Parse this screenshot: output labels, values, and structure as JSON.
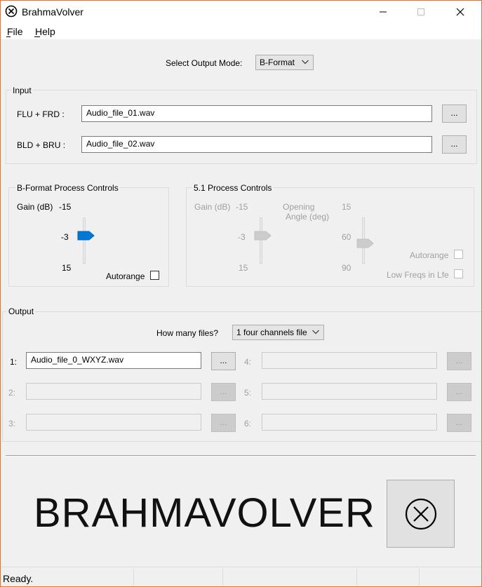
{
  "window": {
    "title": "BrahmaVolver",
    "icon": "circle-x-icon"
  },
  "menu": {
    "file": "File",
    "help": "Help"
  },
  "output_mode": {
    "label": "Select Output Mode:",
    "value": "B-Format"
  },
  "input": {
    "title": "Input",
    "row1_label": "FLU + FRD :",
    "row1_value": "Audio_file_01.wav",
    "row2_label": "BLD + BRU :",
    "row2_value": "Audio_file_02.wav",
    "browse": "..."
  },
  "bformat": {
    "title": "B-Format Process Controls",
    "gain_label": "Gain (dB)",
    "gain_min": "-15",
    "gain_mid": "-3",
    "gain_max": "15",
    "gain_value": -3,
    "autorange": "Autorange",
    "autorange_checked": false
  },
  "five_one": {
    "title": "5.1 Process Controls",
    "gain_label": "Gain (dB)",
    "gain_min": "-15",
    "gain_mid": "-3",
    "gain_max": "15",
    "opening_label": "Opening",
    "angle_label": "Angle (deg)",
    "angle_min": "15",
    "angle_mid": "60",
    "angle_max": "90",
    "autorange": "Autorange",
    "low_freqs": "Low Freqs in Lfe"
  },
  "output": {
    "title": "Output",
    "files_label": "How many files?",
    "files_value": "1 four channels file",
    "browse": "...",
    "slots": [
      {
        "label": "1:",
        "value": "Audio_file_0_WXYZ.wav",
        "enabled": true
      },
      {
        "label": "2:",
        "value": "",
        "enabled": false
      },
      {
        "label": "3:",
        "value": "",
        "enabled": false
      },
      {
        "label": "4:",
        "value": "",
        "enabled": false
      },
      {
        "label": "5:",
        "value": "",
        "enabled": false
      },
      {
        "label": "6:",
        "value": "",
        "enabled": false
      }
    ]
  },
  "logo": {
    "text": "BRAHMAVOLVER",
    "icon": "circle-x-icon"
  },
  "status": {
    "text": "Ready."
  },
  "colors": {
    "accent": "#0078d7",
    "frame": "#e8722a",
    "disabled_text": "#a0a0a0"
  }
}
